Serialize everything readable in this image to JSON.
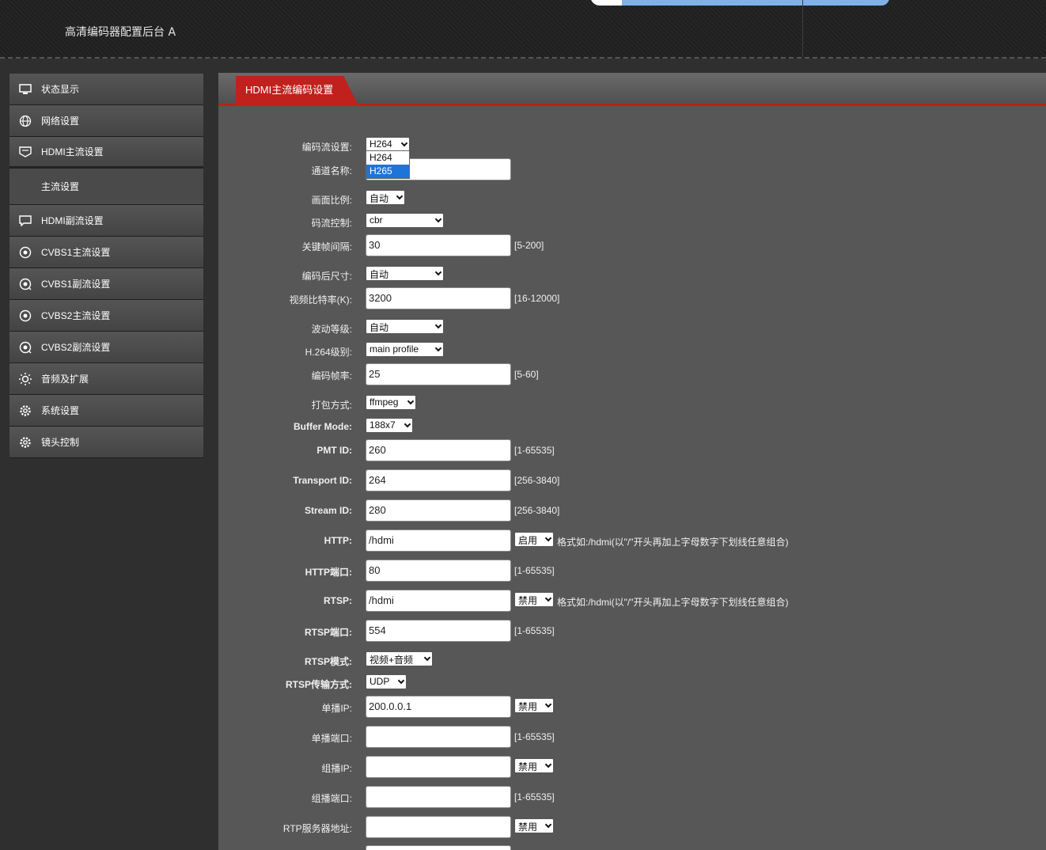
{
  "header": {
    "title": "高清编码器配置后台 A"
  },
  "sidebar": {
    "items": [
      {
        "label": "状态显示",
        "icon": "monitor-icon"
      },
      {
        "label": "网络设置",
        "icon": "globe-icon"
      },
      {
        "label": "HDMI主流设置",
        "icon": "display-icon"
      },
      {
        "label": "主流设置",
        "icon": ""
      },
      {
        "label": "HDMI副流设置",
        "icon": "display-chat-icon"
      },
      {
        "label": "CVBS1主流设置",
        "icon": "camera-icon"
      },
      {
        "label": "CVBS1副流设置",
        "icon": "camera-icon"
      },
      {
        "label": "CVBS2主流设置",
        "icon": "camera-icon"
      },
      {
        "label": "CVBS2副流设置",
        "icon": "camera-icon"
      },
      {
        "label": "音频及扩展",
        "icon": "gear-sparkle-icon"
      },
      {
        "label": "系统设置",
        "icon": "gear-icon"
      },
      {
        "label": "镜头控制",
        "icon": "gear-icon"
      }
    ]
  },
  "panel": {
    "tab": "HDMI主流编码设置"
  },
  "form": {
    "codec": {
      "label": "编码流设置:",
      "value": "H264",
      "options": [
        "H264",
        "H265"
      ]
    },
    "channel_name": {
      "label": "通道名称:",
      "value": ""
    },
    "aspect": {
      "label": "画面比例:",
      "value": "自动"
    },
    "rate_control": {
      "label": "码流控制:",
      "value": "cbr"
    },
    "gop": {
      "label": "关键帧间隔:",
      "value": "30",
      "hint": "[5-200]"
    },
    "size": {
      "label": "编码后尺寸:",
      "value": "自动"
    },
    "bitrate": {
      "label": "视频比特率(K):",
      "value": "3200",
      "hint": "[16-12000]"
    },
    "fluct": {
      "label": "波动等级:",
      "value": "自动"
    },
    "profile": {
      "label": "H.264级别:",
      "value": "main profile"
    },
    "fps": {
      "label": "编码帧率:",
      "value": "25",
      "hint": "[5-60]"
    },
    "pack": {
      "label": "打包方式:",
      "value": "ffmpeg"
    },
    "buffer": {
      "label": "Buffer Mode:",
      "value": "188x7"
    },
    "pmt": {
      "label": "PMT ID:",
      "value": "260",
      "hint": "[1-65535]"
    },
    "transport": {
      "label": "Transport ID:",
      "value": "264",
      "hint": "[256-3840]"
    },
    "stream": {
      "label": "Stream ID:",
      "value": "280",
      "hint": "[256-3840]"
    },
    "http": {
      "label": "HTTP:",
      "value": "/hdmi",
      "toggle": "启用",
      "hint": "格式如:/hdmi(以\"/\"开头再加上字母数字下划线任意组合)"
    },
    "http_port": {
      "label": "HTTP端口:",
      "value": "80",
      "hint": "[1-65535]"
    },
    "rtsp": {
      "label": "RTSP:",
      "value": "/hdmi",
      "toggle": "禁用",
      "hint": "格式如:/hdmi(以\"/\"开头再加上字母数字下划线任意组合)"
    },
    "rtsp_port": {
      "label": "RTSP端口:",
      "value": "554",
      "hint": "[1-65535]"
    },
    "rtsp_mode": {
      "label": "RTSP模式:",
      "value": "视频+音频"
    },
    "rtsp_trans": {
      "label": "RTSP传输方式:",
      "value": "UDP"
    },
    "unicast_ip": {
      "label": "单播IP:",
      "value": "200.0.0.1",
      "toggle": "禁用"
    },
    "unicast_port": {
      "label": "单播端口:",
      "value": "",
      "hint": "[1-65535]"
    },
    "multicast_ip": {
      "label": "组播IP:",
      "value": "",
      "toggle": "禁用"
    },
    "multicast_port": {
      "label": "组播端口:",
      "value": "",
      "hint": "[1-65535]"
    },
    "rtp_server": {
      "label": "RTP服务器地址:",
      "value": "",
      "toggle": "禁用"
    }
  }
}
